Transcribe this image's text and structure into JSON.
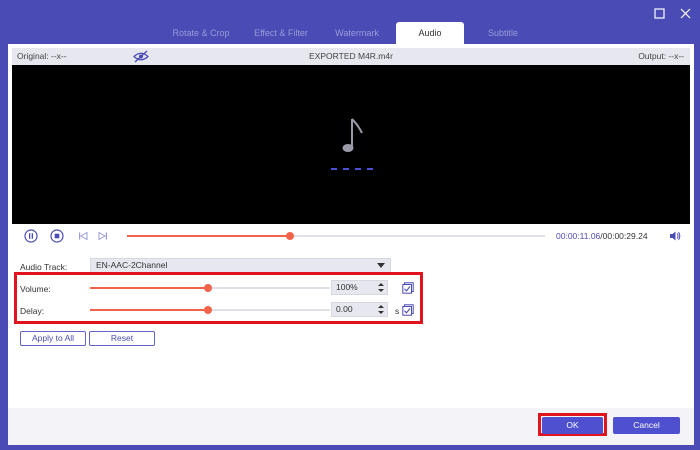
{
  "tabs": [
    {
      "label": "Rotate & Crop",
      "active": false
    },
    {
      "label": "Effect & Filter",
      "active": false
    },
    {
      "label": "Watermark",
      "active": false
    },
    {
      "label": "Audio",
      "active": true
    },
    {
      "label": "Subtitle",
      "active": false
    }
  ],
  "preview": {
    "original_label": "Original: --x--",
    "file_name": "EXPORTED M4R.m4r",
    "output_label": "Output: --x--"
  },
  "playback": {
    "current_time": "00:00:11.06",
    "total_time": "/00:00:29.24",
    "progress": 0.39
  },
  "audio": {
    "track_label": "Audio Track:",
    "track_value": "EN-AAC-2Channel",
    "volume_label": "Volume:",
    "volume_value": "100%",
    "volume_level": 0.49,
    "delay_label": "Delay:",
    "delay_value": "0.00",
    "delay_unit": "s",
    "delay_level": 0.49
  },
  "buttons": {
    "apply_all": "Apply to All",
    "reset": "Reset",
    "ok": "OK",
    "cancel": "Cancel"
  },
  "colors": {
    "accent": "#4a4bb4",
    "slider": "#f16449",
    "highlight": "#e0141e"
  }
}
